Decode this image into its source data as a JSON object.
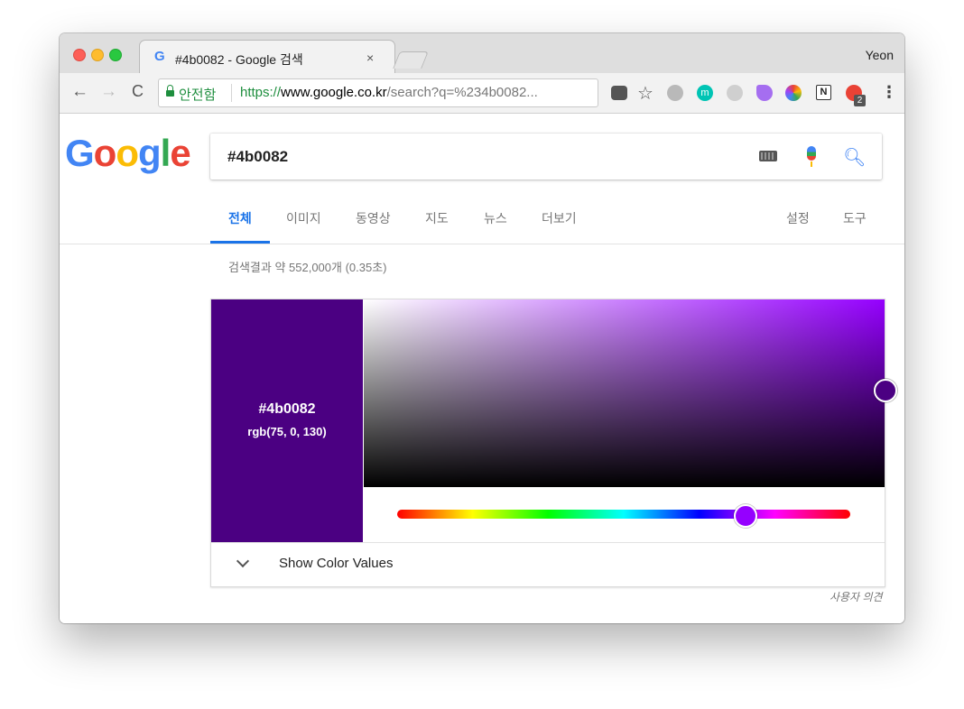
{
  "browser": {
    "tab_title": "#4b0082 - Google 검색",
    "tab_close": "×",
    "tab_favicon": "G",
    "profile_name": "Yeon",
    "omnibox": {
      "secure_label": "안전함",
      "url_scheme": "https://",
      "url_host": "www.google.co.kr",
      "url_path": "/search?q=%234b0082..."
    },
    "extensions": [
      "pocket-icon",
      "bookmark-star-icon",
      "globe-icon",
      "m-extension-icon",
      "camera-extension-icon",
      "pie-extension-icon",
      "color-wheel-icon",
      "n-extension-icon",
      "g-extension-icon"
    ],
    "badge_count": "2"
  },
  "google": {
    "logo": [
      "G",
      "o",
      "o",
      "g",
      "l",
      "e"
    ],
    "logo_colors": [
      "#4285f4",
      "#ea4335",
      "#fbbc05",
      "#4285f4",
      "#34a853",
      "#ea4335"
    ],
    "query": "#4b0082",
    "nav_tabs": [
      "전체",
      "이미지",
      "동영상",
      "지도",
      "뉴스",
      "더보기"
    ],
    "nav_right": [
      "설정",
      "도구"
    ],
    "result_stats": "검색결과 약 552,000개 (0.35초)"
  },
  "color_picker": {
    "hex": "#4b0082",
    "rgb": "rgb(75, 0, 130)",
    "show_values_label": "Show Color Values",
    "swatch_color": "#4b0082",
    "hue_color": "#9500ff"
  },
  "feedback_label": "사용자 의견"
}
